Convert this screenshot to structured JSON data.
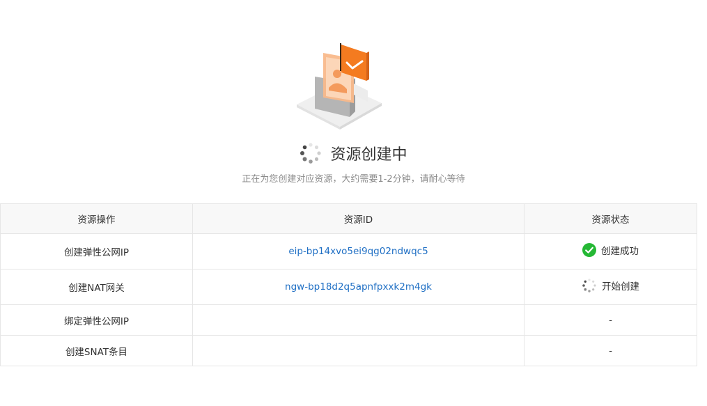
{
  "header": {
    "title": "资源创建中",
    "subtitle": "正在为您创建对应资源，大约需要1-2分钟，请耐心等待"
  },
  "table": {
    "columns": [
      "资源操作",
      "资源ID",
      "资源状态"
    ],
    "rows": [
      {
        "operation": "创建弹性公网IP",
        "resource_id": "eip-bp14xvo5ei9qg02ndwqc5",
        "status": "创建成功",
        "status_icon": "check-circle-icon"
      },
      {
        "operation": "创建NAT网关",
        "resource_id": "ngw-bp18d2q5apnfpxxk2m4gk",
        "status": "开始创建",
        "status_icon": "spinner-icon"
      },
      {
        "operation": "绑定弹性公网IP",
        "resource_id": "",
        "status": "-"
      },
      {
        "operation": "创建SNAT条目",
        "resource_id": "",
        "status": "-"
      }
    ]
  },
  "colors": {
    "accent_orange": "#f47b20",
    "link_blue": "#1f6fc4",
    "success_green": "#25b835"
  }
}
